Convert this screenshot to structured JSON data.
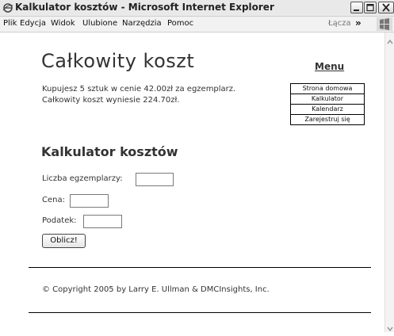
{
  "window": {
    "title": "Kalkulator kosztów - Microsoft Internet Explorer"
  },
  "menubar": {
    "items": [
      "Plik",
      "Edycja",
      "Widok",
      "Ulubione",
      "Narzędzia",
      "Pomoc"
    ],
    "links_label": "Łącza",
    "chevron": "»"
  },
  "page": {
    "title": "Całkowity koszt",
    "result_line1": "Kupujesz 5 sztuk w cenie 42.00zł za egzemplarz.",
    "result_line2": "Całkowity koszt wyniesie 224.70zł.",
    "calculator_title": "Kalkulator kosztów",
    "form": {
      "quantity_label": "Liczba egzemplarzy:",
      "quantity_value": "",
      "price_label": "Cena:",
      "price_value": "",
      "tax_label": "Podatek:",
      "tax_value": "",
      "submit_label": "Oblicz!"
    },
    "copyright": "© Copyright 2005 by Larry E. Ullman & DMCInsights, Inc."
  },
  "nav": {
    "heading": "Menu",
    "items": [
      "Strona domowa",
      "Kalkulator",
      "Kalendarz",
      "Zarejestruj się"
    ]
  }
}
